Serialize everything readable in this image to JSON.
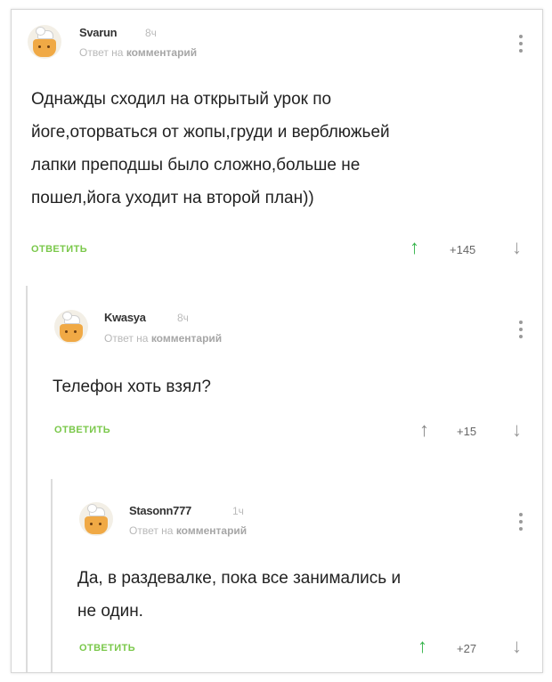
{
  "colors": {
    "upvote_active": "#35b44a",
    "upvote_neutral": "#888888",
    "reply_green": "#7ac84a"
  },
  "comments": [
    {
      "username": "Svarun",
      "time": "8ч",
      "reply_prefix": "Ответ на",
      "reply_link": "комментарий",
      "text_lines": [
        "Однажды сходил на открытый урок по",
        "йоге,оторваться от жопы,груди и верблюжьей",
        "лапки преподшы было сложно,больше не",
        "пошел,йога уходит на второй план))"
      ],
      "reply_label": "ОТВЕТИТЬ",
      "score": "+145",
      "upvoted": true
    },
    {
      "username": "Kwasya",
      "time": "8ч",
      "reply_prefix": "Ответ на",
      "reply_link": "комментарий",
      "text_lines": [
        "Телефон хоть взял?"
      ],
      "reply_label": "ОТВЕТИТЬ",
      "score": "+15",
      "upvoted": false
    },
    {
      "username": "Stasonn777",
      "time": "1ч",
      "reply_prefix": "Ответ на",
      "reply_link": "комментарий",
      "text_lines": [
        "Да, в раздевалке, пока все занимались и",
        "не один."
      ],
      "reply_label": "ОТВЕТИТЬ",
      "score": "+27",
      "upvoted": true
    }
  ],
  "icons": {
    "avatar": "chef-avatar-icon",
    "menu": "more-vertical-icon",
    "up": "arrow-up-icon",
    "down": "arrow-down-icon"
  },
  "glyphs": {
    "up": "↑",
    "down": "↓"
  }
}
